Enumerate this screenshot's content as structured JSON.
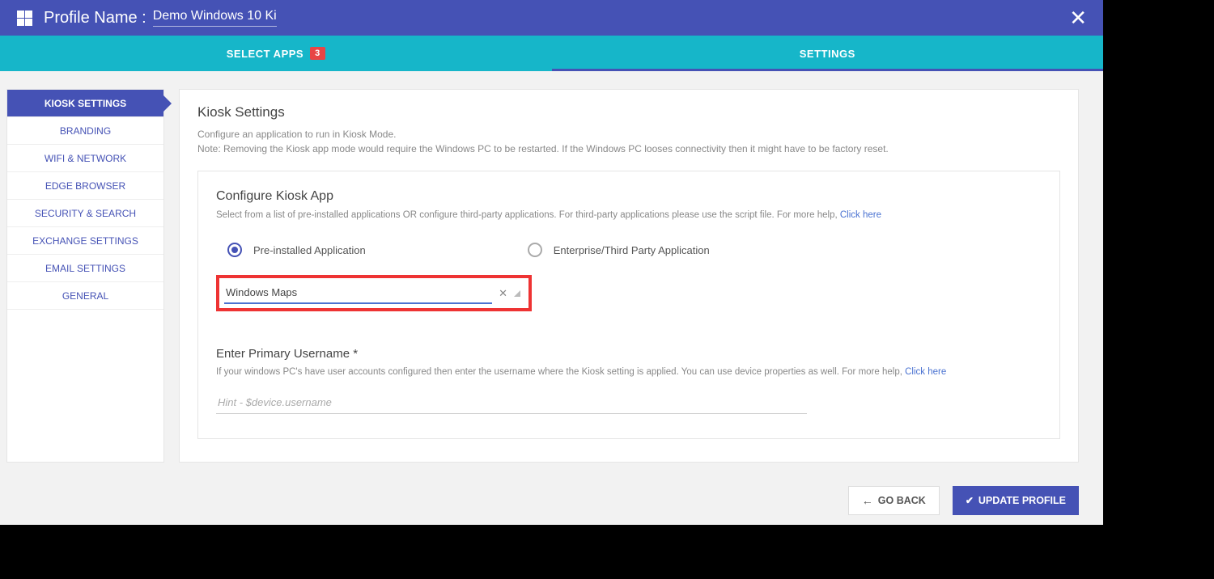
{
  "header": {
    "profile_label": "Profile Name :",
    "profile_name": "Demo Windows 10 Ki"
  },
  "tabs": [
    {
      "label": "SELECT APPS",
      "badge": "3",
      "active": false
    },
    {
      "label": "SETTINGS",
      "badge": null,
      "active": true
    }
  ],
  "sidebar": {
    "items": [
      {
        "label": "KIOSK SETTINGS",
        "active": true
      },
      {
        "label": "BRANDING",
        "active": false
      },
      {
        "label": "WIFI & NETWORK",
        "active": false
      },
      {
        "label": "EDGE BROWSER",
        "active": false
      },
      {
        "label": "SECURITY & SEARCH",
        "active": false
      },
      {
        "label": "EXCHANGE SETTINGS",
        "active": false
      },
      {
        "label": "EMAIL SETTINGS",
        "active": false
      },
      {
        "label": "GENERAL",
        "active": false
      }
    ]
  },
  "main": {
    "title": "Kiosk Settings",
    "desc1": "Configure an application to run in Kiosk Mode.",
    "desc2": "Note: Removing the Kiosk app mode would require the Windows PC to be restarted. If the Windows PC looses connectivity then it might have to be factory reset.",
    "card": {
      "title": "Configure Kiosk App",
      "desc": "Select from a list of pre-installed applications OR configure third-party applications. For third-party applications please use the script file. For more help, ",
      "link": "Click here",
      "radios": [
        {
          "label": "Pre-installed Application",
          "selected": true
        },
        {
          "label": "Enterprise/Third Party Application",
          "selected": false
        }
      ],
      "select_value": "Windows Maps",
      "username_title": "Enter Primary Username *",
      "username_desc": "If your windows PC's have user accounts configured then enter the username where the Kiosk setting is applied. You can use device properties as well. For more help, ",
      "username_link": "Click here",
      "username_placeholder": "Hint - $device.username"
    }
  },
  "footer": {
    "back": "GO BACK",
    "update": "UPDATE PROFILE"
  }
}
